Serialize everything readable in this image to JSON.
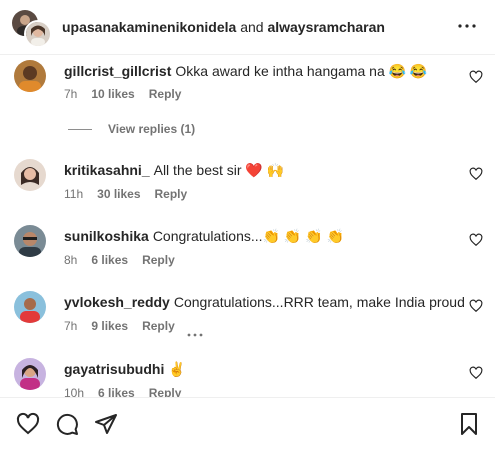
{
  "header": {
    "user1": "upasanakaminenikonidela",
    "joiner": "and",
    "user2": "alwaysramcharan",
    "icons": {
      "more": "more-options-icon"
    }
  },
  "comments": [
    {
      "username": "gillcrist_gillcrist",
      "text": "Okka award ke intha hangama na 😂 😂",
      "time": "7h",
      "likes": "10 likes",
      "reply": "Reply",
      "view_replies": "View replies (1)"
    },
    {
      "username": "kritikasahni_",
      "text": "All the best sir ❤️ 🙌",
      "time": "11h",
      "likes": "30 likes",
      "reply": "Reply"
    },
    {
      "username": "sunilkoshika",
      "text": "Congratulations...👏 👏 👏 👏",
      "time": "8h",
      "likes": "6 likes",
      "reply": "Reply"
    },
    {
      "username": "yvlokesh_reddy",
      "text": "Congratulations...RRR team, make India proud",
      "time": "7h",
      "likes": "9 likes",
      "reply": "Reply"
    },
    {
      "username": "gayatrisubudhi",
      "text": "✌️",
      "time": "10h",
      "likes": "6 likes",
      "reply": "Reply"
    }
  ],
  "footer": {
    "icons": [
      "heart-icon",
      "comment-icon",
      "share-icon",
      "bookmark-icon"
    ]
  },
  "colors": {
    "text": "#262626",
    "secondary": "#737373",
    "divider": "#efefef"
  }
}
